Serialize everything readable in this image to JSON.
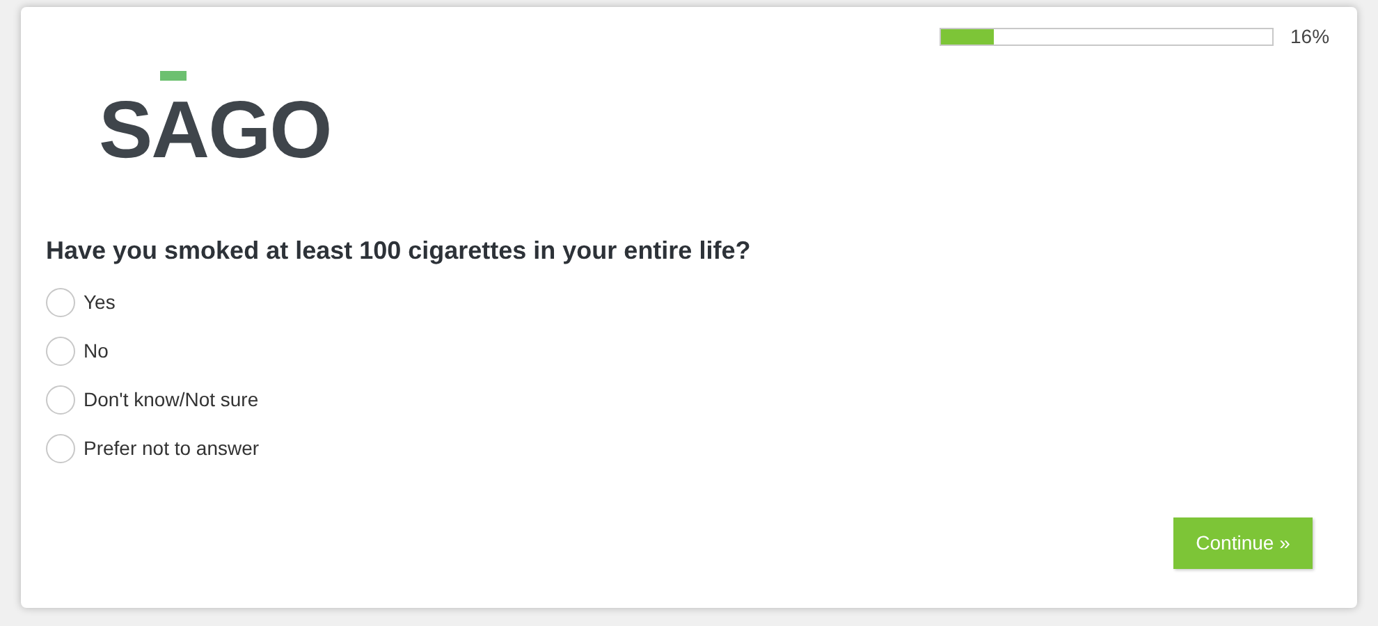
{
  "progress": {
    "level": 0.16,
    "reading": "16%"
  },
  "logo": {
    "text": "SAGO"
  },
  "question": {
    "text": "Have you smoked at least 100 cigarettes in your entire life?",
    "options": [
      {
        "label": "Yes",
        "selected": false
      },
      {
        "label": "No",
        "selected": false
      },
      {
        "label": "Don't know/Not sure",
        "selected": false
      },
      {
        "label": "Prefer not to answer",
        "selected": false
      }
    ]
  },
  "continue_button": {
    "label": "Continue »"
  }
}
